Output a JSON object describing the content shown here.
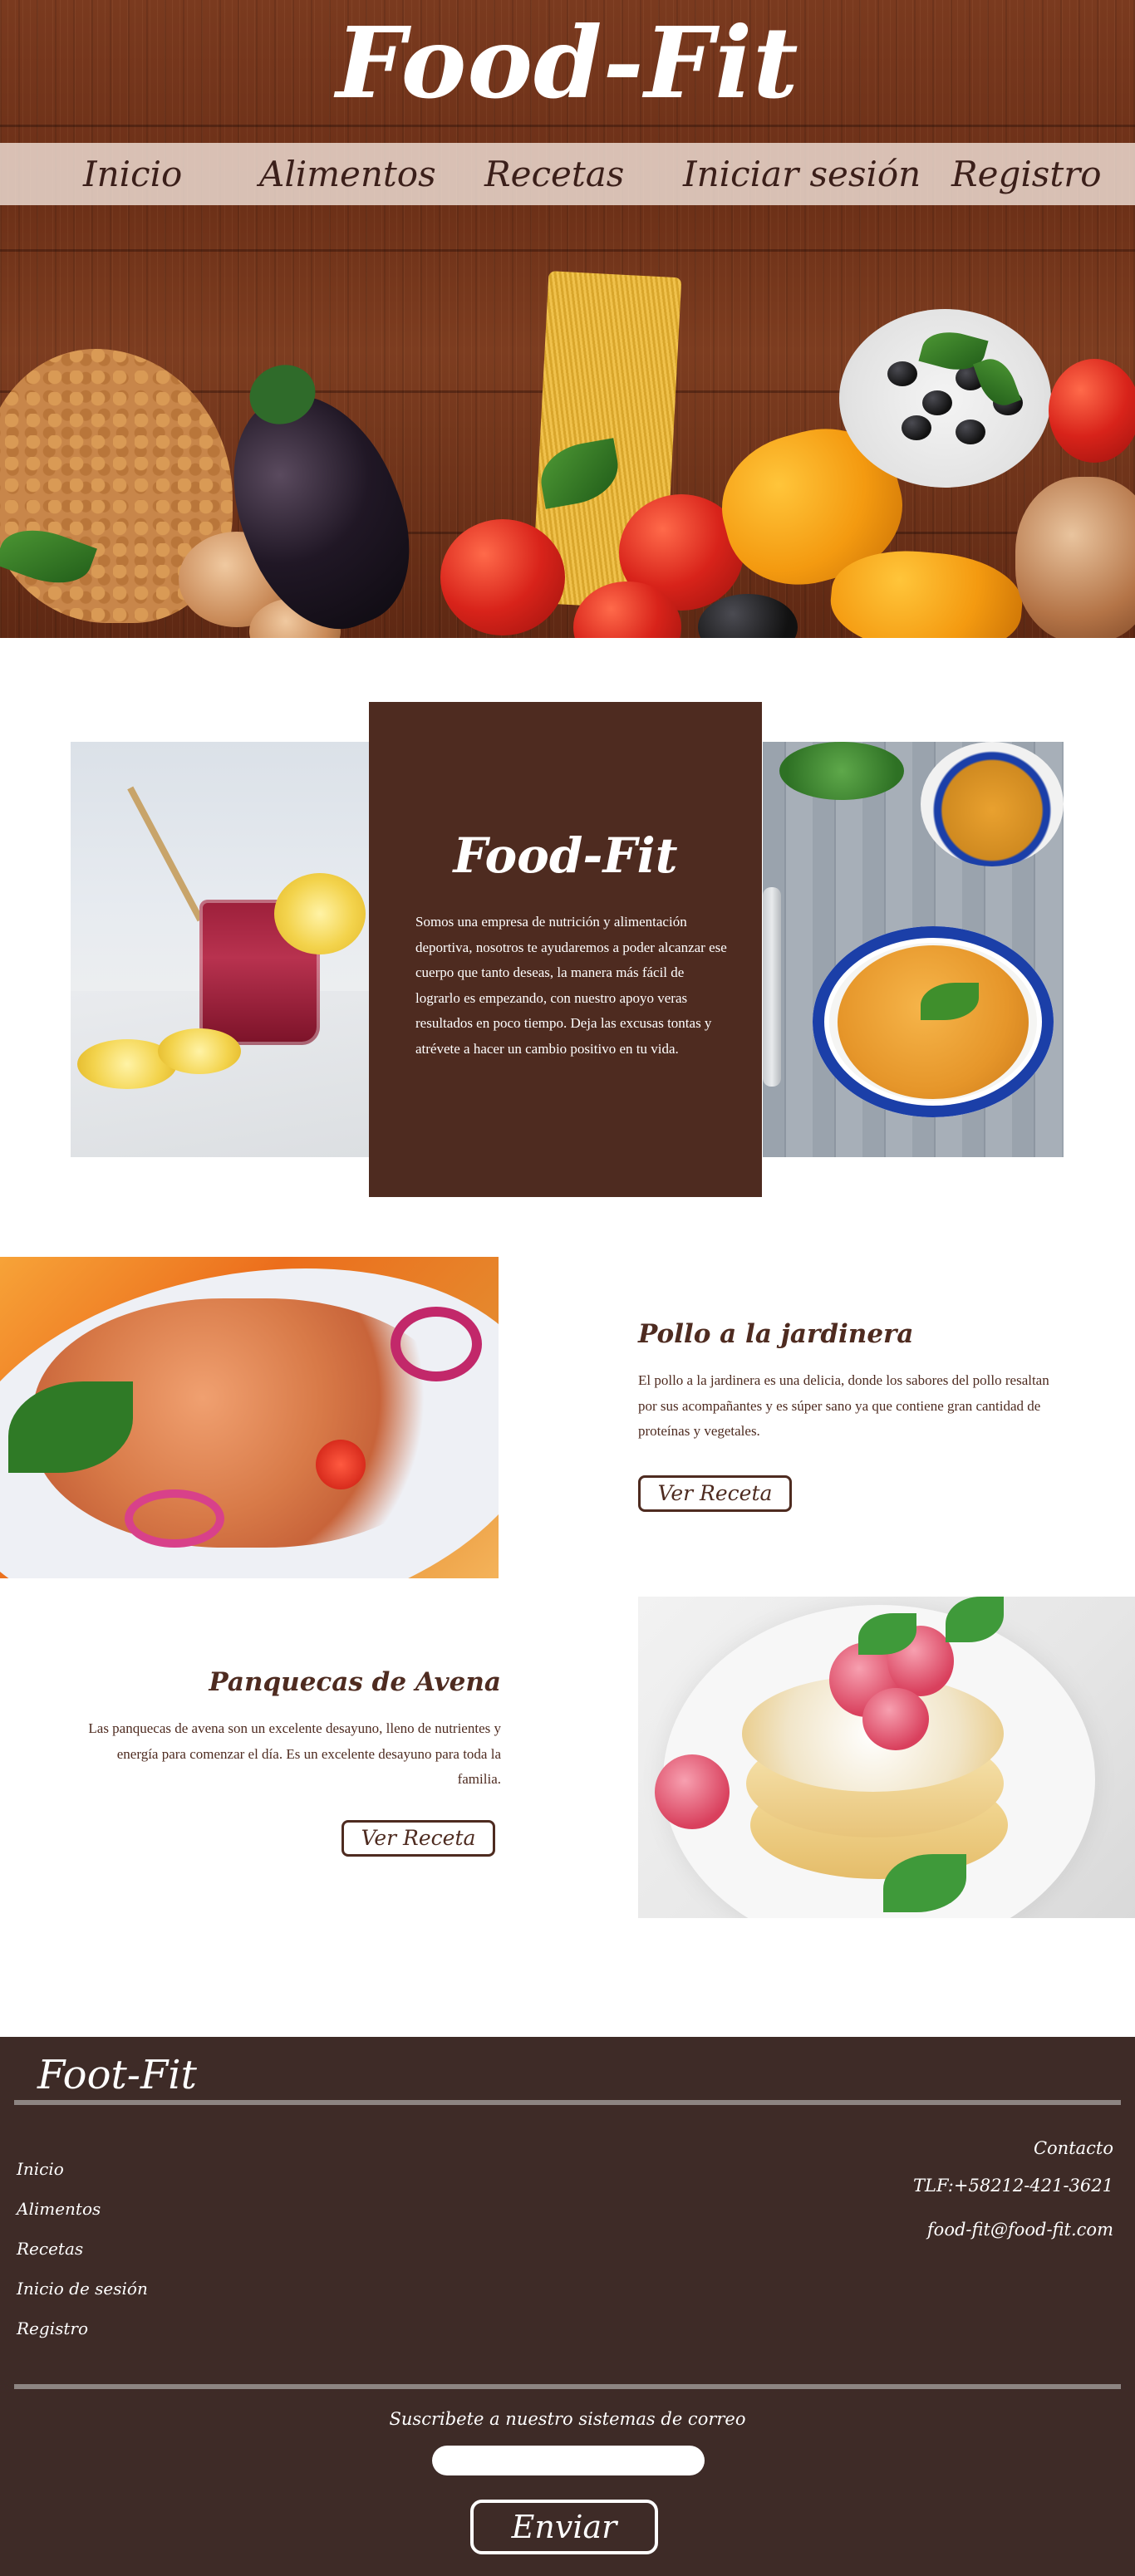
{
  "header": {
    "site_title": "Food-Fit",
    "nav": [
      {
        "label": "Inicio"
      },
      {
        "label": "Alimentos"
      },
      {
        "label": "Recetas"
      },
      {
        "label": "Iniciar sesión"
      },
      {
        "label": "Registro"
      }
    ]
  },
  "about": {
    "title": "Food-Fit",
    "text": "Somos una empresa de nutrición y alimentación deportiva, nosotros te ayudaremos  a poder alcanzar ese cuerpo que tanto deseas, la manera más fácil de lograrlo es empezando, con nuestro apoyo veras resultados en poco tiempo. Deja  las excusas tontas y atrévete a hacer un cambio positivo en tu vida."
  },
  "recipes": [
    {
      "title": "Pollo a la jardinera",
      "description": "El pollo a la jardinera es una delicia, donde los sabores del pollo resaltan por sus acompañantes  y es súper sano ya que contiene gran cantidad de proteínas y vegetales.",
      "button": "Ver Receta"
    },
    {
      "title": "Panquecas de Avena",
      "description": "Las panquecas de avena son un excelente desayuno, lleno de nutrientes y energía para comenzar el día. Es un excelente desayuno para toda la familia.",
      "button": "Ver Receta"
    }
  ],
  "footer": {
    "brand": "Foot-Fit",
    "links": [
      {
        "label": "Inicio"
      },
      {
        "label": "Alimentos"
      },
      {
        "label": "Recetas"
      },
      {
        "label": "Inicio de sesión"
      },
      {
        "label": "Registro"
      }
    ],
    "contact": {
      "heading": "Contacto",
      "phone": "TLF:+58212-421-3621",
      "email": "food-fit@food-fit.com"
    },
    "subscribe": {
      "label": "Suscribete a nuestro sistemas de correo",
      "input_value": "",
      "button": "Enviar"
    }
  },
  "colors": {
    "brand_brown": "#4e2b20",
    "footer_bg": "#3e2b27",
    "nav_bar": "#f0e1d7"
  }
}
